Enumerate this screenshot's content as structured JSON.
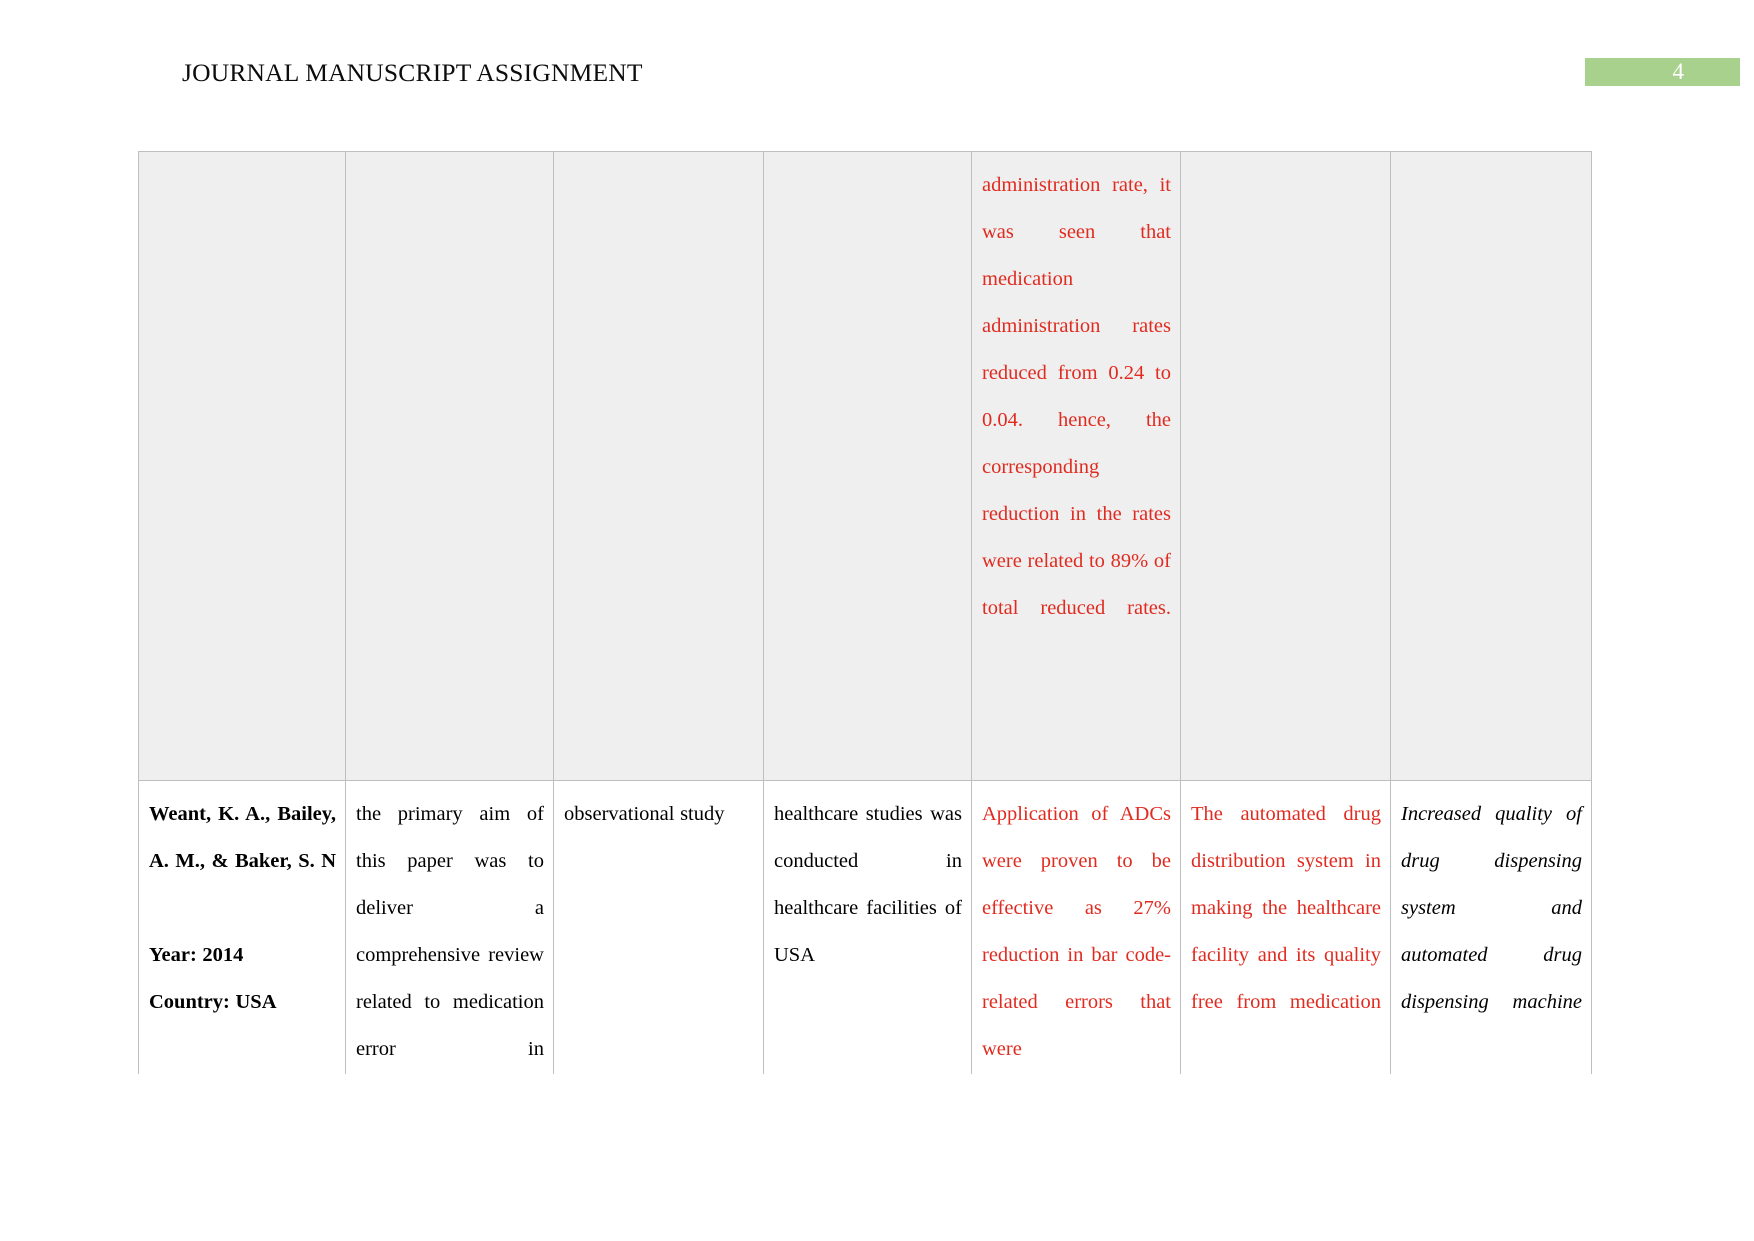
{
  "header": {
    "title": "JOURNAL MANUSCRIPT ASSIGNMENT",
    "page_number": "4",
    "badge_color": "#a9d18e"
  },
  "colors": {
    "highlight_text": "#e02b20",
    "body_text": "#000000",
    "table_border": "#bfbfbf",
    "shaded_row_background": "#efefef"
  },
  "table": {
    "column_count": 7,
    "rows": [
      {
        "name": "continued-row",
        "shaded": true,
        "cells": [
          {
            "text": "",
            "style": "plain"
          },
          {
            "text": "",
            "style": "plain"
          },
          {
            "text": "",
            "style": "plain"
          },
          {
            "text": "",
            "style": "plain"
          },
          {
            "text": "administration rate, it was seen that medication administration rates reduced from 0.24 to 0.04. hence, the corresponding reduction in the rates were related to 89% of total reduced rates.",
            "style": "red"
          },
          {
            "text": "",
            "style": "plain"
          },
          {
            "text": "",
            "style": "plain"
          }
        ]
      },
      {
        "name": "entry-row",
        "shaded": false,
        "cells": [
          {
            "text": "Weant, K. A., Bailey, A. M., & Baker, S. N",
            "style": "bold",
            "line2": "Year: 2014",
            "line3": "Country: USA"
          },
          {
            "text": "the primary aim of this paper was to deliver a comprehensive review related to medication error in",
            "style": "plain"
          },
          {
            "text": "observational study",
            "style": "plain"
          },
          {
            "text": "healthcare studies was conducted in healthcare facilities of USA",
            "style": "plain"
          },
          {
            "text": "Application of ADCs were proven to be effective as 27% reduction in bar code-related errors that were",
            "style": "red"
          },
          {
            "text": "The automated drug distribution system in making the healthcare facility and its quality free from medication",
            "style": "red"
          },
          {
            "text": "Increased quality of drug dispensing system and automated drug dispensing machine",
            "style": "italic"
          }
        ]
      }
    ]
  }
}
